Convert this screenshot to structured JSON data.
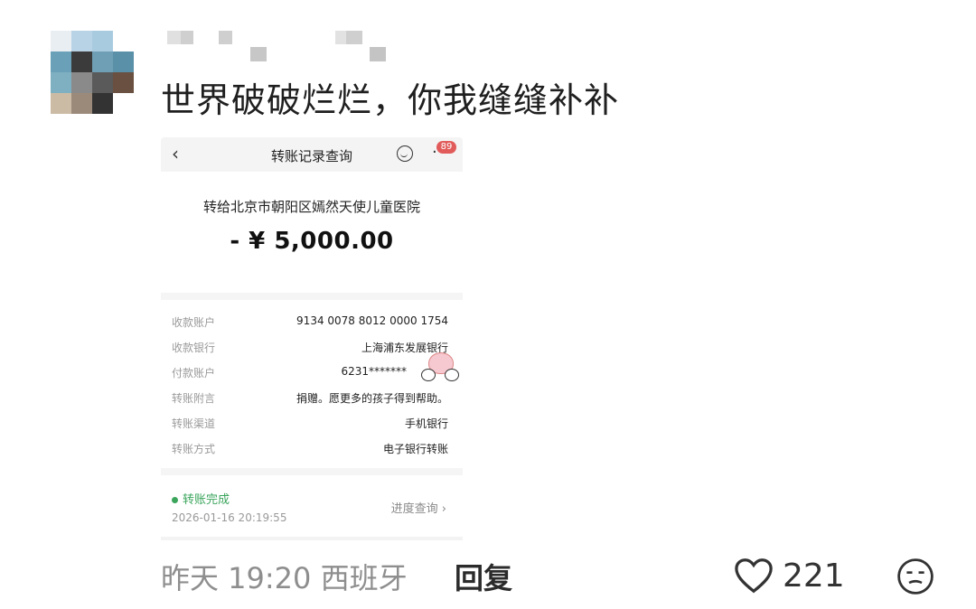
{
  "comment": {
    "text": "世界破破烂烂，你我缝缝补补",
    "meta": "昨天 19:20 西班牙",
    "reply_label": "回复",
    "like_count": "221",
    "icons": [
      "avatar-pixelated",
      "heart-icon",
      "face-icon"
    ]
  },
  "receipt": {
    "title": "转账记录查询",
    "badge": "89",
    "recipient": "转给北京市朝阳区嫣然天使儿童医院",
    "amount": "- ¥ 5,000.00",
    "rows": [
      {
        "label": "收款账户",
        "value": "9134 0078 8012 0000 1754"
      },
      {
        "label": "收款银行",
        "value": "上海浦东发展银行"
      },
      {
        "label": "付款账户",
        "value": "6231*******"
      },
      {
        "label": "转账附言",
        "value": "捐赠。愿更多的孩子得到帮助。"
      },
      {
        "label": "转账渠道",
        "value": "手机银行"
      },
      {
        "label": "转账方式",
        "value": "电子银行转账"
      }
    ],
    "status": "转账完成",
    "status_time": "2026-01-16 20:19:55",
    "progress_link": "进度查询",
    "status_color": "#3aa55b",
    "badge_color": "#e25b5b"
  }
}
